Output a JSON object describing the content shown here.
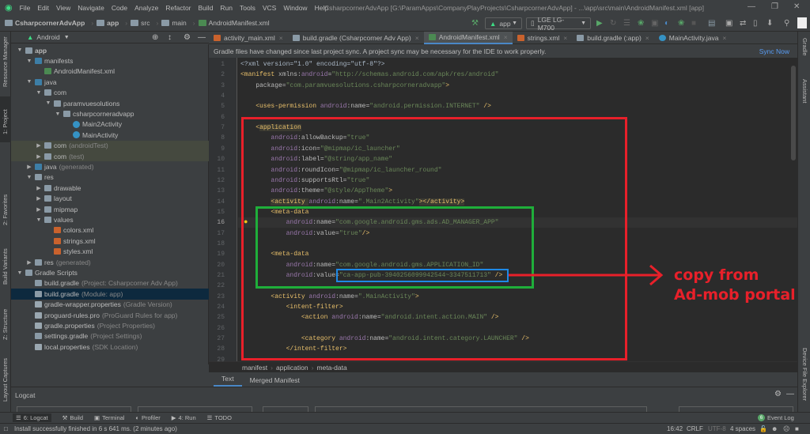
{
  "menubar": {
    "items": [
      "File",
      "Edit",
      "View",
      "Navigate",
      "Code",
      "Analyze",
      "Refactor",
      "Build",
      "Run",
      "Tools",
      "VCS",
      "Window",
      "Help"
    ],
    "window_title": "CsharpcornerAdvApp [G:\\ParamApps\\CompanyPlayProjects\\CsharpcornerAdvApp] - ...\\app\\src\\main\\AndroidManifest.xml [app]"
  },
  "navbar": {
    "crumbs": [
      "CsharpcornerAdvApp",
      "app",
      "src",
      "main",
      "AndroidManifest.xml"
    ],
    "config": "app",
    "device": "LGE LG-M700"
  },
  "project_panel": {
    "view": "Android",
    "tree": [
      {
        "label": "app",
        "hint": "",
        "level": 0,
        "arrow": "down",
        "icon": "module",
        "bold": true
      },
      {
        "label": "manifests",
        "hint": "",
        "level": 1,
        "arrow": "down",
        "icon": "folder-blue"
      },
      {
        "label": "AndroidManifest.xml",
        "hint": "",
        "level": 2,
        "arrow": "",
        "icon": "manifest"
      },
      {
        "label": "java",
        "hint": "",
        "level": 1,
        "arrow": "down",
        "icon": "folder-blue"
      },
      {
        "label": "com",
        "hint": "",
        "level": 2,
        "arrow": "down",
        "icon": "package"
      },
      {
        "label": "paramvuesolutions",
        "hint": "",
        "level": 3,
        "arrow": "down",
        "icon": "package"
      },
      {
        "label": "csharpcorneradvapp",
        "hint": "",
        "level": 4,
        "arrow": "down",
        "icon": "package"
      },
      {
        "label": "Main2Activity",
        "hint": "",
        "level": 5,
        "arrow": "",
        "icon": "class"
      },
      {
        "label": "MainActivity",
        "hint": "",
        "level": 5,
        "arrow": "",
        "icon": "class"
      },
      {
        "label": "com",
        "hint": "(androidTest)",
        "level": 2,
        "arrow": "right",
        "icon": "package",
        "state": "hl"
      },
      {
        "label": "com",
        "hint": "(test)",
        "level": 2,
        "arrow": "right",
        "icon": "package",
        "state": "hl"
      },
      {
        "label": "java",
        "hint": "(generated)",
        "level": 1,
        "arrow": "right",
        "icon": "folder-blue"
      },
      {
        "label": "res",
        "hint": "",
        "level": 1,
        "arrow": "down",
        "icon": "folder-res"
      },
      {
        "label": "drawable",
        "hint": "",
        "level": 2,
        "arrow": "right",
        "icon": "package"
      },
      {
        "label": "layout",
        "hint": "",
        "level": 2,
        "arrow": "right",
        "icon": "package"
      },
      {
        "label": "mipmap",
        "hint": "",
        "level": 2,
        "arrow": "right",
        "icon": "package"
      },
      {
        "label": "values",
        "hint": "",
        "level": 2,
        "arrow": "down",
        "icon": "package"
      },
      {
        "label": "colors.xml",
        "hint": "",
        "level": 3,
        "arrow": "",
        "icon": "xml"
      },
      {
        "label": "strings.xml",
        "hint": "",
        "level": 3,
        "arrow": "",
        "icon": "xml"
      },
      {
        "label": "styles.xml",
        "hint": "",
        "level": 3,
        "arrow": "",
        "icon": "xml"
      },
      {
        "label": "res",
        "hint": "(generated)",
        "level": 1,
        "arrow": "right",
        "icon": "folder-res"
      },
      {
        "label": "Gradle Scripts",
        "hint": "",
        "level": 0,
        "arrow": "down",
        "icon": "gradle"
      },
      {
        "label": "build.gradle",
        "hint": "(Project: Csharpcorner Adv App)",
        "level": 1,
        "arrow": "",
        "icon": "gradle"
      },
      {
        "label": "build.gradle",
        "hint": "(Module: app)",
        "level": 1,
        "arrow": "",
        "icon": "gradle",
        "state": "sel"
      },
      {
        "label": "gradle-wrapper.properties",
        "hint": "(Gradle Version)",
        "level": 1,
        "arrow": "",
        "icon": "props"
      },
      {
        "label": "proguard-rules.pro",
        "hint": "(ProGuard Rules for app)",
        "level": 1,
        "arrow": "",
        "icon": "file"
      },
      {
        "label": "gradle.properties",
        "hint": "(Project Properties)",
        "level": 1,
        "arrow": "",
        "icon": "props"
      },
      {
        "label": "settings.gradle",
        "hint": "(Project Settings)",
        "level": 1,
        "arrow": "",
        "icon": "gradle"
      },
      {
        "label": "local.properties",
        "hint": "(SDK Location)",
        "level": 1,
        "arrow": "",
        "icon": "props"
      }
    ]
  },
  "left_stripe": [
    "Resource Manager",
    "1: Project",
    "2: Favorites",
    "Build Variants",
    "Z: Structure",
    "Layout Captures"
  ],
  "right_stripe": [
    "Gradle",
    "Assistant",
    "Device File Explorer"
  ],
  "tabs": [
    {
      "label": "activity_main.xml",
      "icon": "xml",
      "active": false
    },
    {
      "label": "build.gradle (Csharpcorner Adv App)",
      "icon": "gradle",
      "active": false
    },
    {
      "label": "AndroidManifest.xml",
      "icon": "manifest",
      "active": true
    },
    {
      "label": "strings.xml",
      "icon": "xml",
      "active": false
    },
    {
      "label": "build.gradle (:app)",
      "icon": "gradle",
      "active": false
    },
    {
      "label": "MainActivity.java",
      "icon": "class",
      "active": false
    }
  ],
  "notification": {
    "text": "Gradle files have changed since last project sync. A project sync may be necessary for the IDE to work properly.",
    "action": "Sync Now"
  },
  "code": [
    [
      [
        "plain",
        "<?xml version=\"1.0\" encoding=\"utf-8\"?>"
      ]
    ],
    [
      [
        "tag",
        "<manifest "
      ],
      [
        "attr",
        "xmlns:"
      ],
      [
        "ns",
        "android"
      ],
      [
        "attr",
        "="
      ],
      [
        "val",
        "\"http://schemas.android.com/apk/res/android\""
      ]
    ],
    [
      [
        "plain",
        "    "
      ],
      [
        "attr",
        "package="
      ],
      [
        "val",
        "\"com.paramvuesolutions.csharpcorneradvapp\""
      ],
      [
        "tag",
        ">"
      ]
    ],
    [],
    [
      [
        "plain",
        "    "
      ],
      [
        "tag",
        "<uses-permission "
      ],
      [
        "ns",
        "android"
      ],
      [
        "attr",
        ":name="
      ],
      [
        "val",
        "\"android.permission.INTERNET\""
      ],
      [
        "tag",
        " />"
      ]
    ],
    [],
    [
      [
        "plain",
        "    "
      ],
      [
        "tag",
        "<"
      ],
      [
        "tagbg",
        "application"
      ]
    ],
    [
      [
        "plain",
        "        "
      ],
      [
        "ns",
        "android"
      ],
      [
        "attr",
        ":allowBackup="
      ],
      [
        "val",
        "\"true\""
      ]
    ],
    [
      [
        "plain",
        "        "
      ],
      [
        "ns",
        "android"
      ],
      [
        "attr",
        ":icon="
      ],
      [
        "val",
        "\"@mipmap/ic_launcher\""
      ]
    ],
    [
      [
        "plain",
        "        "
      ],
      [
        "ns",
        "android"
      ],
      [
        "attr",
        ":label="
      ],
      [
        "val",
        "\"@string/app_name\""
      ]
    ],
    [
      [
        "plain",
        "        "
      ],
      [
        "ns",
        "android"
      ],
      [
        "attr",
        ":roundIcon="
      ],
      [
        "val",
        "\"@mipmap/ic_launcher_round\""
      ]
    ],
    [
      [
        "plain",
        "        "
      ],
      [
        "ns",
        "android"
      ],
      [
        "attr",
        ":supportsRtl="
      ],
      [
        "val",
        "\"true\""
      ]
    ],
    [
      [
        "plain",
        "        "
      ],
      [
        "ns",
        "android"
      ],
      [
        "attr",
        ":theme="
      ],
      [
        "val",
        "\"@style/AppTheme\""
      ],
      [
        "tag",
        ">"
      ]
    ],
    [
      [
        "plain",
        "        "
      ],
      [
        "tagbg",
        "<activity "
      ],
      [
        "ns",
        "android"
      ],
      [
        "attr",
        ":name="
      ],
      [
        "val",
        "\".Main2Activity\""
      ],
      [
        "tagbg",
        "></activity>"
      ]
    ],
    [
      [
        "plain",
        "        "
      ],
      [
        "tag",
        "<meta-data"
      ]
    ],
    [
      [
        "plain",
        "            "
      ],
      [
        "ns",
        "android"
      ],
      [
        "attr",
        ":name="
      ],
      [
        "val",
        "\"com.google.android.gms.ads.AD_MANAGER_APP\""
      ]
    ],
    [
      [
        "plain",
        "            "
      ],
      [
        "ns",
        "android"
      ],
      [
        "attr",
        ":value="
      ],
      [
        "val",
        "\"true\""
      ],
      [
        "tag",
        "/>"
      ]
    ],
    [],
    [
      [
        "plain",
        "        "
      ],
      [
        "tag",
        "<meta-data"
      ]
    ],
    [
      [
        "plain",
        "            "
      ],
      [
        "ns",
        "android"
      ],
      [
        "attr",
        ":name="
      ],
      [
        "val",
        "\"com.google.android.gms.APPLICATION_ID\""
      ]
    ],
    [
      [
        "plain",
        "            "
      ],
      [
        "ns",
        "android"
      ],
      [
        "attr",
        ":value="
      ],
      [
        "val",
        "\"ca-app-pub-3940256099942544~3347511713\""
      ],
      [
        "tag",
        " />"
      ]
    ],
    [],
    [
      [
        "plain",
        "        "
      ],
      [
        "tag",
        "<activity "
      ],
      [
        "ns",
        "android"
      ],
      [
        "attr",
        ":name="
      ],
      [
        "val",
        "\".MainActivity\""
      ],
      [
        "tag",
        ">"
      ]
    ],
    [
      [
        "plain",
        "            "
      ],
      [
        "tag",
        "<intent-filter>"
      ]
    ],
    [
      [
        "plain",
        "                "
      ],
      [
        "tag",
        "<action "
      ],
      [
        "ns",
        "android"
      ],
      [
        "attr",
        ":name="
      ],
      [
        "val",
        "\"android.intent.action.MAIN\""
      ],
      [
        "tag",
        " />"
      ]
    ],
    [],
    [
      [
        "plain",
        "                "
      ],
      [
        "tag",
        "<category "
      ],
      [
        "ns",
        "android"
      ],
      [
        "attr",
        ":name="
      ],
      [
        "val",
        "\"android.intent.category.LAUNCHER\""
      ],
      [
        "tag",
        " />"
      ]
    ],
    [
      [
        "plain",
        "            "
      ],
      [
        "tag",
        "</intent-filter>"
      ]
    ],
    []
  ],
  "current_line": 16,
  "editor_breadcrumb": [
    "manifest",
    "application",
    "meta-data"
  ],
  "editor_tabs": [
    "Text",
    "Merged Manifest"
  ],
  "logcat": {
    "title": "Logcat"
  },
  "tool_windows": [
    "6: Logcat",
    "Build",
    "Terminal",
    "Profiler",
    "4: Run",
    "TODO"
  ],
  "event_log": {
    "label": "Event Log",
    "count": "6"
  },
  "status": {
    "message": "Install successfully finished in 6 s 641 ms. (2 minutes ago)",
    "position": "16:42",
    "line_sep": "CRLF",
    "encoding": "UTF-8",
    "indent": "4 spaces"
  },
  "annotation": {
    "line1": "copy from",
    "line2": "Ad-mob portal",
    "color": "#e8202a"
  },
  "colors": {
    "editor_bg": "#2b2b2b",
    "panel_bg": "#3c3f41",
    "tag": "#e8bf6a",
    "value": "#6a8759",
    "namespace": "#9876aa",
    "accent": "#4a88c7"
  }
}
